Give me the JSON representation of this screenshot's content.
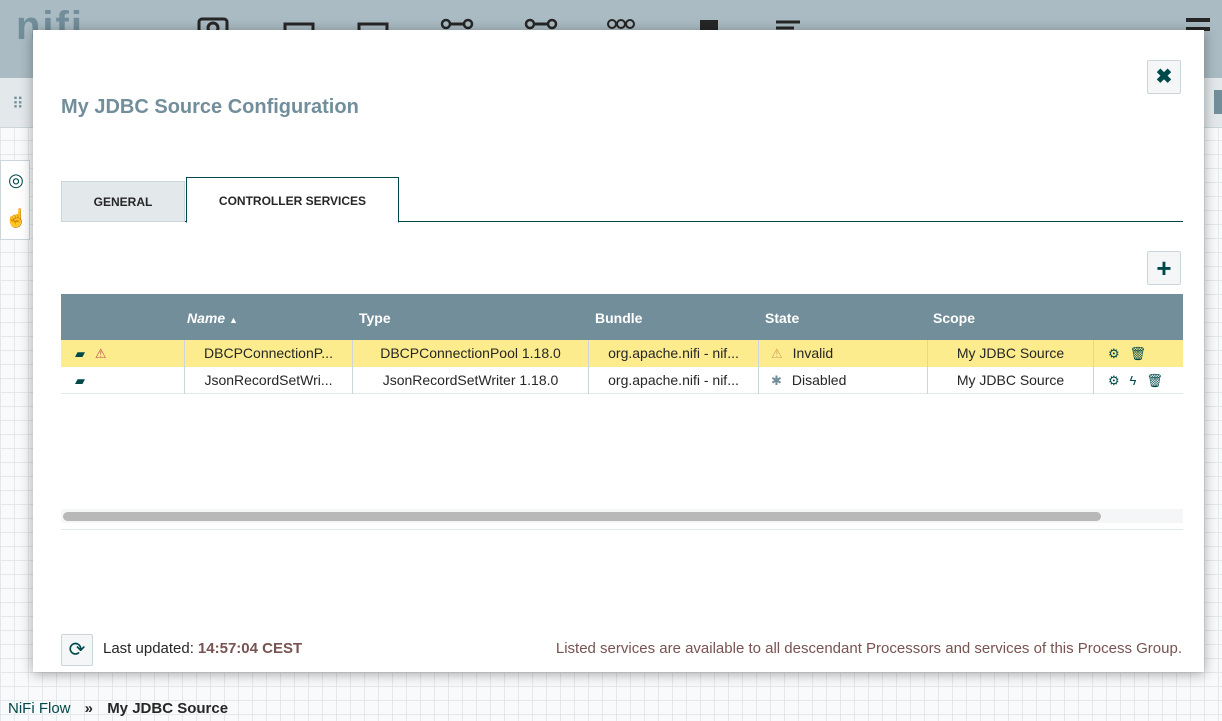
{
  "background": {
    "logo": "nifi",
    "breadcrumbs": {
      "root": "NiFi Flow",
      "separator": "»",
      "current": "My JDBC Source"
    }
  },
  "dialog": {
    "title": "My JDBC Source Configuration",
    "close_icon": "close-icon",
    "tabs": [
      {
        "label": "GENERAL",
        "active": false
      },
      {
        "label": "CONTROLLER SERVICES",
        "active": true
      }
    ],
    "add_icon": "plus-icon",
    "table": {
      "columns": [
        "",
        "Name",
        "Type",
        "Bundle",
        "State",
        "Scope",
        ""
      ],
      "sort_indicator": "▲",
      "rows": [
        {
          "name": "DBCPConnectionP...",
          "type": "DBCPConnectionPool 1.18.0",
          "bundle": "org.apache.nifi - nif...",
          "state": "Invalid",
          "scope": "My JDBC Source",
          "status": "invalid",
          "actions": [
            "configure",
            "delete"
          ]
        },
        {
          "name": "JsonRecordSetWri...",
          "type": "JsonRecordSetWriter 1.18.0",
          "bundle": "org.apache.nifi - nif...",
          "state": "Disabled",
          "scope": "My JDBC Source",
          "status": "disabled",
          "actions": [
            "configure",
            "enable",
            "delete"
          ]
        }
      ]
    },
    "footer": {
      "last_updated_label": "Last updated:",
      "last_updated_time": "14:57:04 CEST",
      "note": "Listed services are available to all descendant Processors and services of this Process Group."
    }
  },
  "colors": {
    "accent": "#004849",
    "header": "#728e9b",
    "invalid_row": "#fcec8d",
    "link_text": "#775351"
  }
}
